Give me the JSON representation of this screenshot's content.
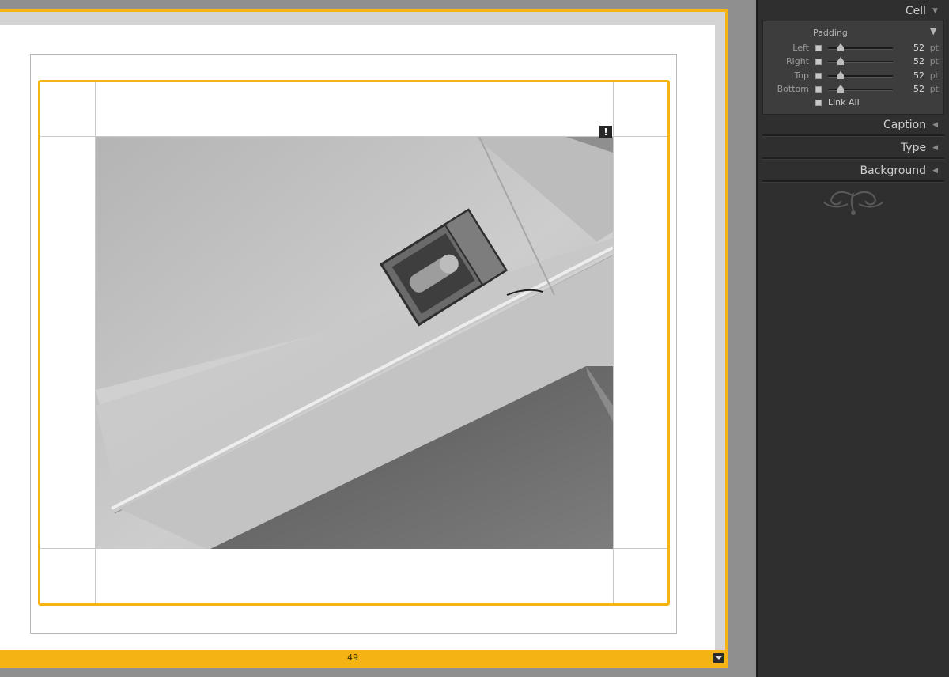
{
  "canvas": {
    "page_number": "49",
    "accent_color": "#f6b414",
    "warning_badge": "!"
  },
  "panel": {
    "cell": {
      "title": "Cell",
      "padding": {
        "label": "Padding",
        "unit": "pt",
        "rows": [
          {
            "label": "Left",
            "value": "52"
          },
          {
            "label": "Right",
            "value": "52"
          },
          {
            "label": "Top",
            "value": "52"
          },
          {
            "label": "Bottom",
            "value": "52"
          }
        ],
        "link_all_label": "Link All"
      }
    },
    "sections": [
      {
        "title": "Caption"
      },
      {
        "title": "Type"
      },
      {
        "title": "Background"
      }
    ]
  }
}
